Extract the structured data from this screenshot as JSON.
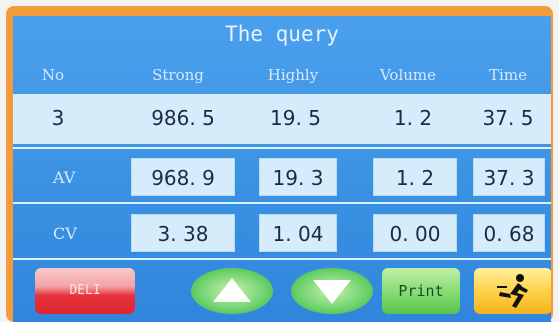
{
  "screen": {
    "title": "The query",
    "columns": [
      "No",
      "Strong",
      "Highly",
      "Volume",
      "Time"
    ],
    "current_row": {
      "no": "3",
      "strong": "986. 5",
      "highly": "19. 5",
      "volume": "1. 2",
      "time": "37. 5"
    },
    "av": {
      "label": "AV",
      "strong": "968. 9",
      "highly": "19. 3",
      "volume": "1. 2",
      "time": "37. 3"
    },
    "cv": {
      "label": "CV",
      "strong": "3. 38",
      "highly": "1. 04",
      "volume": "0. 00",
      "time": "0. 68"
    }
  },
  "buttons": {
    "delete_label": "DELI",
    "up_icon": "triangle-up-icon",
    "down_icon": "triangle-down-icon",
    "print_label": "Print",
    "run_icon": "running-man-icon"
  },
  "colors": {
    "frame": "#f39a3c",
    "screen": "#3b93e4",
    "cell": "#d6ecfb",
    "delete": "#e0262f",
    "nav": "#6bd16b",
    "print": "#7fd86e",
    "run": "#ffd24a"
  }
}
